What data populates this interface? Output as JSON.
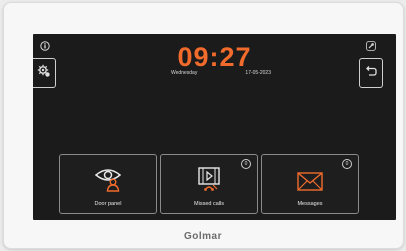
{
  "status": {
    "time": "09:27",
    "weekday": "Wednesday",
    "date": "17-05-2023"
  },
  "tiles": [
    {
      "label": "Door panel",
      "badge": ""
    },
    {
      "label": "Missed calls",
      "badge": "0"
    },
    {
      "label": "Messages",
      "badge": "0"
    }
  ],
  "brand": {
    "name": "Golmar"
  },
  "colors": {
    "accent": "#f06b2c",
    "screen": "#1b1b1b"
  },
  "icons": {
    "top_left": "info-icon",
    "top_right": "tool-icon",
    "settings": "settings-gear-icon",
    "back": "back-arrow-icon"
  }
}
